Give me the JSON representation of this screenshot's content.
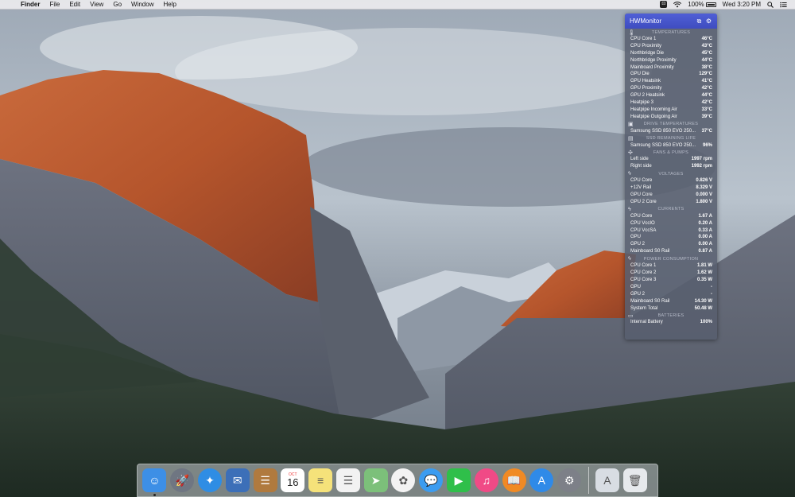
{
  "menubar": {
    "app_name": "Finder",
    "menus": [
      "File",
      "Edit",
      "View",
      "Go",
      "Window",
      "Help"
    ],
    "battery": "100%",
    "clock": "Wed 3:20 PM",
    "icons": [
      "apple-icon",
      "hwmonitor-icon",
      "wifi-icon",
      "battery-icon",
      "search-icon",
      "notification-center-icon"
    ]
  },
  "hwmonitor": {
    "title": "HWMonitor",
    "sections": [
      {
        "name": "TEMPERATURES",
        "icon": "thermometer-icon",
        "rows": [
          {
            "label": "CPU Core 1",
            "value": "46°C"
          },
          {
            "label": "CPU Proximity",
            "value": "43°C"
          },
          {
            "label": "Northbridge Die",
            "value": "45°C"
          },
          {
            "label": "Northbridge Proximity",
            "value": "44°C"
          },
          {
            "label": "Mainboard Proximity",
            "value": "38°C"
          },
          {
            "label": "GPU Die",
            "value": "129°C"
          },
          {
            "label": "GPU Heatsink",
            "value": "41°C"
          },
          {
            "label": "GPU Proximity",
            "value": "42°C"
          },
          {
            "label": "GPU 2 Heatsink",
            "value": "44°C"
          },
          {
            "label": "Heatpipe 3",
            "value": "42°C"
          },
          {
            "label": "Heatpipe Incoming Air",
            "value": "33°C"
          },
          {
            "label": "Heatpipe Outgoing Air",
            "value": "39°C"
          }
        ]
      },
      {
        "name": "DRIVE TEMPERATURES",
        "icon": "drive-icon",
        "rows": [
          {
            "label": "Samsung SSD 850 EVO 250...",
            "value": "37°C"
          }
        ]
      },
      {
        "name": "SSD REMAINING LIFE",
        "icon": "ssd-icon",
        "rows": [
          {
            "label": "Samsung SSD 850 EVO 250...",
            "value": "96%"
          }
        ]
      },
      {
        "name": "FANS & PUMPS",
        "icon": "fan-icon",
        "rows": [
          {
            "label": "Left side",
            "value": "1997 rpm"
          },
          {
            "label": "Right side",
            "value": "1992 rpm"
          }
        ]
      },
      {
        "name": "VOLTAGES",
        "icon": "lightning-icon",
        "rows": [
          {
            "label": "CPU Core",
            "value": "0.826 V"
          },
          {
            "label": "+12V Rail",
            "value": "8.329 V"
          },
          {
            "label": "GPU Core",
            "value": "0.000 V"
          },
          {
            "label": "GPU 2 Core",
            "value": "1.800 V"
          }
        ]
      },
      {
        "name": "CURRENTS",
        "icon": "lightning-icon",
        "rows": [
          {
            "label": "CPU Core",
            "value": "1.67 A"
          },
          {
            "label": "CPU VccIO",
            "value": "0.20 A"
          },
          {
            "label": "CPU VccSA",
            "value": "0.33 A"
          },
          {
            "label": "GPU",
            "value": "0.00 A"
          },
          {
            "label": "GPU 2",
            "value": "0.00 A"
          },
          {
            "label": "Mainboard S0 Rail",
            "value": "0.87 A"
          }
        ]
      },
      {
        "name": "POWER CONSUMPTION",
        "icon": "lightning-icon",
        "rows": [
          {
            "label": "CPU Core 1",
            "value": "1.81 W"
          },
          {
            "label": "CPU Core 2",
            "value": "1.62 W"
          },
          {
            "label": "CPU Core 3",
            "value": "0.35 W"
          },
          {
            "label": "GPU",
            "value": "-"
          },
          {
            "label": "GPU 2",
            "value": "-"
          },
          {
            "label": "Mainboard S0 Rail",
            "value": "14.30 W"
          },
          {
            "label": "System Total",
            "value": "50.48 W"
          }
        ]
      },
      {
        "name": "BATTERIES",
        "icon": "battery-icon",
        "rows": [
          {
            "label": "Internal Battery",
            "value": "100%"
          }
        ]
      }
    ]
  },
  "dock": {
    "calendar_month": "OCT",
    "calendar_day": "16",
    "items": [
      {
        "name": "finder",
        "color": "#3d8fe6",
        "glyph": "☺",
        "running": true
      },
      {
        "name": "launchpad",
        "color": "#6f7682",
        "glyph": "🚀",
        "round": true
      },
      {
        "name": "safari",
        "color": "#2f8de4",
        "glyph": "✦",
        "round": true
      },
      {
        "name": "mail",
        "color": "#3c6fb8",
        "glyph": "✉"
      },
      {
        "name": "contacts",
        "color": "#b07a3e",
        "glyph": "☰"
      },
      {
        "name": "calendar",
        "color": "#ffffff",
        "glyph": ""
      },
      {
        "name": "notes",
        "color": "#f5e27a",
        "glyph": "≡"
      },
      {
        "name": "reminders",
        "color": "#f2f2f2",
        "glyph": "☰"
      },
      {
        "name": "maps",
        "color": "#7cc07a",
        "glyph": "➤"
      },
      {
        "name": "photos",
        "color": "#f3f3f3",
        "glyph": "✿",
        "round": true
      },
      {
        "name": "messages",
        "color": "#3b9cf0",
        "glyph": "💬",
        "round": true
      },
      {
        "name": "facetime",
        "color": "#2fbf4a",
        "glyph": "▶"
      },
      {
        "name": "itunes",
        "color": "#f04a86",
        "glyph": "♫",
        "round": true
      },
      {
        "name": "ibooks",
        "color": "#f08a24",
        "glyph": "📖",
        "round": true
      },
      {
        "name": "app-store",
        "color": "#2f8ae8",
        "glyph": "A",
        "round": true
      },
      {
        "name": "system-preferences",
        "color": "#7d8088",
        "glyph": "⚙",
        "round": true
      }
    ],
    "right_items": [
      {
        "name": "applications-folder",
        "color": "#d8dde3",
        "glyph": "A"
      },
      {
        "name": "trash",
        "color": "#e6e9ec",
        "glyph": "🗑"
      }
    ]
  }
}
